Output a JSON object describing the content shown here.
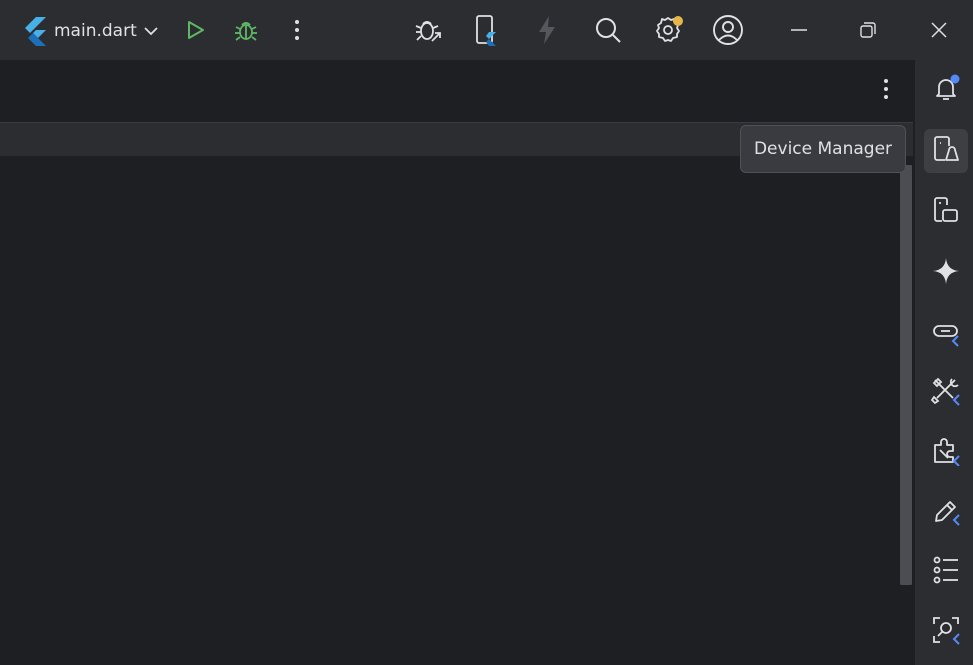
{
  "titlebar": {
    "run_config_label": "main.dart",
    "icons": {
      "flutter_logo": "flutter-logo-icon",
      "run": "run-icon",
      "debug": "debug-icon",
      "more": "more-vertical-icon",
      "attach_debugger": "attach-debugger-icon",
      "device": "flutter-device-icon",
      "hot_reload": "lightning-icon",
      "search": "search-icon",
      "settings": "settings-icon",
      "profile": "profile-icon",
      "minimize": "minimize-icon",
      "restore": "restore-icon",
      "close": "close-icon"
    },
    "colors": {
      "run": "#5fb865",
      "debug": "#5fb865",
      "settings_badge": "#e5b64a"
    }
  },
  "sidebar": {
    "items": [
      {
        "icon": "notifications-icon"
      },
      {
        "icon": "device-manager-icon"
      },
      {
        "icon": "running-devices-icon"
      },
      {
        "icon": "gemini-sparkle-icon"
      },
      {
        "icon": "flutter-deep-links-icon"
      },
      {
        "icon": "flutter-inspector-icon"
      },
      {
        "icon": "flutter-devtools-extensions-icon"
      },
      {
        "icon": "flutter-property-editor-icon"
      },
      {
        "icon": "structure-list-icon"
      },
      {
        "icon": "flutter-widget-finder-icon"
      }
    ],
    "colors": {
      "notification_badge": "#548af7",
      "flutter_accent": "#548af7"
    }
  },
  "tooltip": {
    "text": "Device Manager"
  }
}
